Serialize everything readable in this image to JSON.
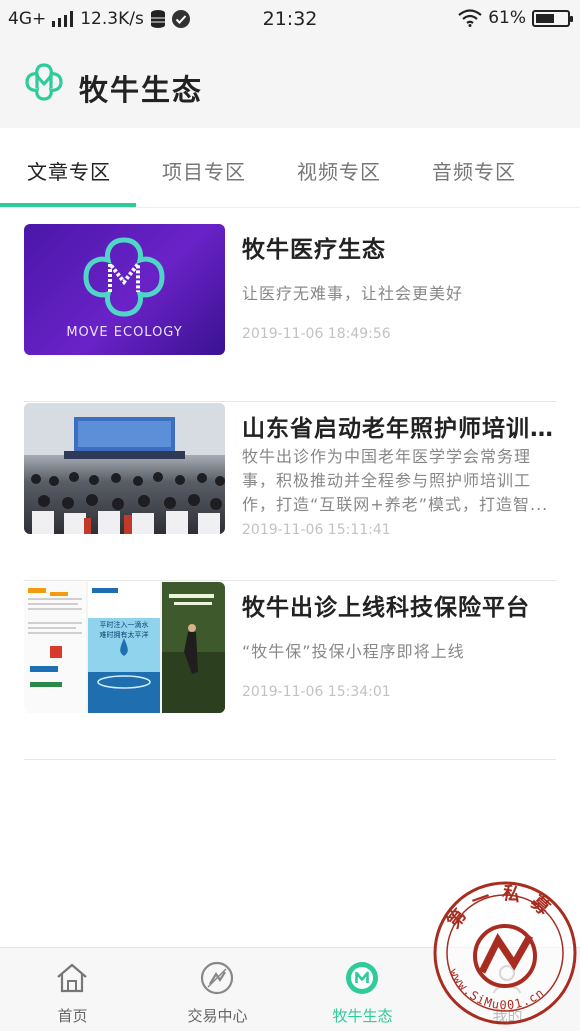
{
  "status_bar": {
    "network": "4G+",
    "speed": "12.3K/s",
    "time": "21:32",
    "battery": "61%",
    "battery_level": 0.61
  },
  "header": {
    "title": "牧牛生态"
  },
  "tabs": [
    {
      "label": "文章专区",
      "active": true
    },
    {
      "label": "项目专区",
      "active": false
    },
    {
      "label": "视频专区",
      "active": false
    },
    {
      "label": "音频专区",
      "active": false
    }
  ],
  "articles": [
    {
      "title": "牧牛医疗生态",
      "desc": "让医疗无难事，让社会更美好",
      "date": "2019-11-06 18:49:56",
      "thumb_text": "MOVE ECOLOGY"
    },
    {
      "title": "山东省启动老年照护师培训...",
      "desc": "牧牛出诊作为中国老年医学学会常务理事，积极推动并全程参与照护师培训工作，打造“互联网+养老”模式，打造智...",
      "date": "2019-11-06 15:11:41"
    },
    {
      "title": "牧牛出诊上线科技保险平台",
      "desc": "“牧牛保”投保小程序即将上线",
      "date": "2019-11-06 15:34:01",
      "thumb_text_1": "平时注入一滴水",
      "thumb_text_2": "难时拥有太平洋"
    }
  ],
  "bottom_nav": [
    {
      "label": "首页",
      "icon": "home-icon"
    },
    {
      "label": "交易中心",
      "icon": "trade-icon"
    },
    {
      "label": "牧牛生态",
      "icon": "ecology-icon",
      "active": true
    },
    {
      "label": "我的",
      "icon": "profile-icon"
    }
  ],
  "watermark": {
    "top_text": "第一私募",
    "bottom_text": "www.SiMu001.cn"
  },
  "colors": {
    "accent": "#2ecc9a",
    "purple": "#5b1fb8"
  }
}
